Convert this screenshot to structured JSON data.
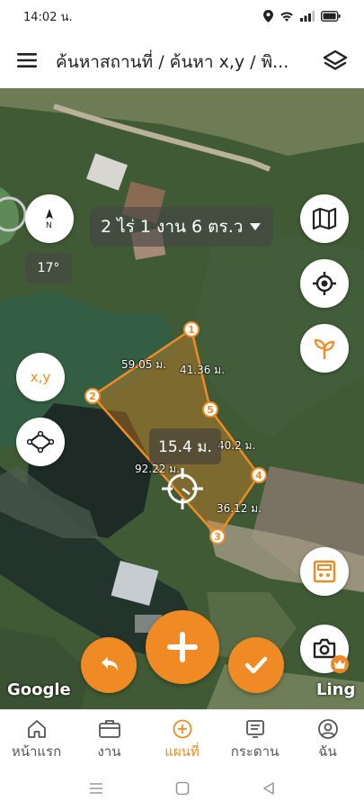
{
  "status_bar": {
    "time": "14:02 น."
  },
  "header": {
    "title": "ค้นหาสถานที่ / ค้นหา x,y / พิ..."
  },
  "map": {
    "area_label": "2 ไร่ 1 งาน 6 ตร.ว",
    "rotation": "17°",
    "xy_label": "x,y",
    "center_distance": "15.4 ม.",
    "distances": [
      "59.05 ม.",
      "41.36 ม.",
      "40.2 ม.",
      "92.22 ม.",
      "36.12 ม."
    ],
    "vertices": [
      "1",
      "2",
      "3",
      "4",
      "5"
    ],
    "google_label": "Google",
    "ling_label": "Ling"
  },
  "bottom_nav": [
    {
      "label": "หน้าแรก",
      "icon": "home-icon"
    },
    {
      "label": "งาน",
      "icon": "briefcase-icon"
    },
    {
      "label": "แผนที่",
      "icon": "map-plus-icon",
      "active": true
    },
    {
      "label": "กระดาน",
      "icon": "board-icon"
    },
    {
      "label": "ฉัน",
      "icon": "user-icon"
    }
  ],
  "colors": {
    "accent": "#f08a24",
    "text": "#222222"
  }
}
